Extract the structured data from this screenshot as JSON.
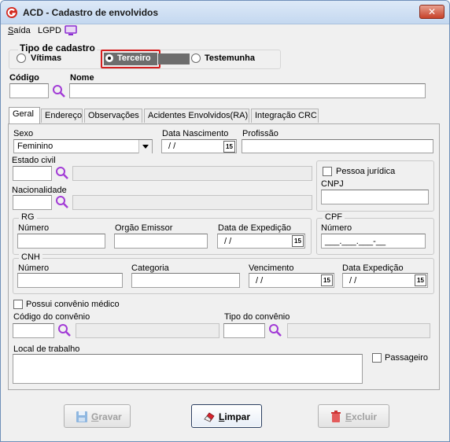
{
  "window": {
    "title": "ACD - Cadastro de envolvidos",
    "close_label": "✕"
  },
  "menu": {
    "saida": "Saída",
    "lgpd": "LGPD"
  },
  "tipo_cadastro": {
    "title": "Tipo de cadastro",
    "options": [
      "Vítimas",
      "Terceiro",
      "Testemunha"
    ],
    "selected": "Terceiro"
  },
  "header_fields": {
    "codigo_label": "Código",
    "nome_label": "Nome",
    "codigo_value": "",
    "nome_value": ""
  },
  "tabs": [
    "Geral",
    "Endereço",
    "Observações",
    "Acidentes Envolvidos(RA)",
    "Integração CRC"
  ],
  "active_tab": "Geral",
  "geral": {
    "sexo_label": "Sexo",
    "sexo_value": "Feminino",
    "data_nascimento_label": "Data Nascimento",
    "data_nascimento_value": "/ /",
    "profissao_label": "Profissão",
    "estado_civil_label": "Estado civil",
    "nacionalidade_label": "Nacionalidade",
    "pessoa_juridica_label": "Pessoa jurídica",
    "cnpj_label": "CNPJ",
    "rg_title": "RG",
    "rg_numero_label": "Número",
    "rg_orgao_label": "Orgão Emissor",
    "rg_data_label": "Data de Expedição",
    "rg_data_value": "/ /",
    "cpf_title": "CPF",
    "cpf_numero_label": "Número",
    "cpf_value": "___.___.___-__",
    "cnh_title": "CNH",
    "cnh_numero_label": "Número",
    "cnh_categoria_label": "Categoria",
    "cnh_vencimento_label": "Vencimento",
    "cnh_vencimento_value": "/ /",
    "cnh_expedicao_label": "Data Expedição",
    "cnh_expedicao_value": "/ /",
    "convenio_label": "Possui convênio médico",
    "codigo_convenio_label": "Código do convênio",
    "tipo_convenio_label": "Tipo do convênio",
    "local_trabalho_label": "Local de trabalho",
    "passageiro_label": "Passageiro",
    "date_button": "15"
  },
  "buttons": {
    "gravar": "Gravar",
    "limpar": "Limpar",
    "excluir": "Excluir"
  }
}
